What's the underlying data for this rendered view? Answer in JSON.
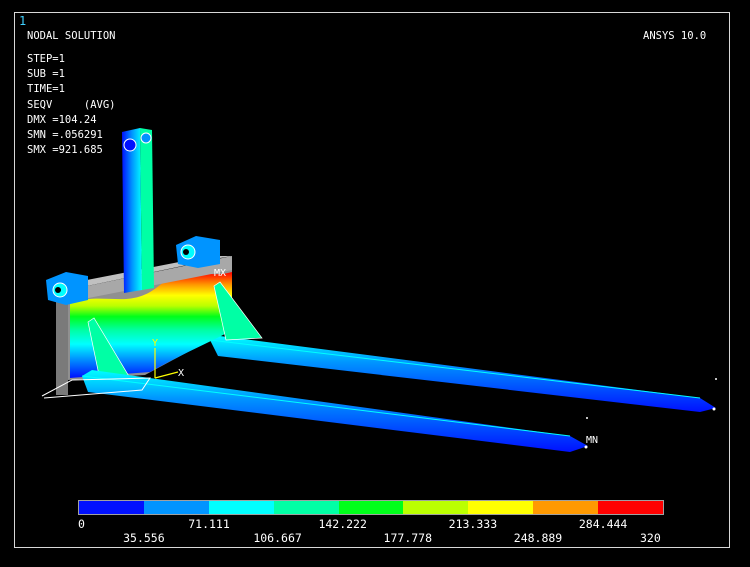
{
  "window": {
    "number": "1",
    "title": "NODAL SOLUTION",
    "version": "ANSYS 10.0"
  },
  "solution": {
    "step": "STEP=1",
    "sub": "SUB =1",
    "time": "TIME=1",
    "seqv": "SEQV     (AVG)",
    "dmx": "DMX =104.24",
    "smn": "SMN =.056291",
    "smx": "SMX =921.685"
  },
  "model_labels": {
    "max": "MX",
    "min": "MN",
    "axis_y": "Y",
    "axis_x": "X"
  },
  "legend": {
    "colors": [
      "#0010ff",
      "#0094ff",
      "#00ffff",
      "#00ffa5",
      "#00ff1a",
      "#bbff00",
      "#ffff00",
      "#ff9900",
      "#ff0000"
    ],
    "ticks_top": [
      "0",
      "71.111",
      "142.222",
      "213.333",
      "284.444"
    ],
    "ticks_bottom": [
      "35.556",
      "106.667",
      "177.778",
      "248.889",
      "320"
    ]
  }
}
